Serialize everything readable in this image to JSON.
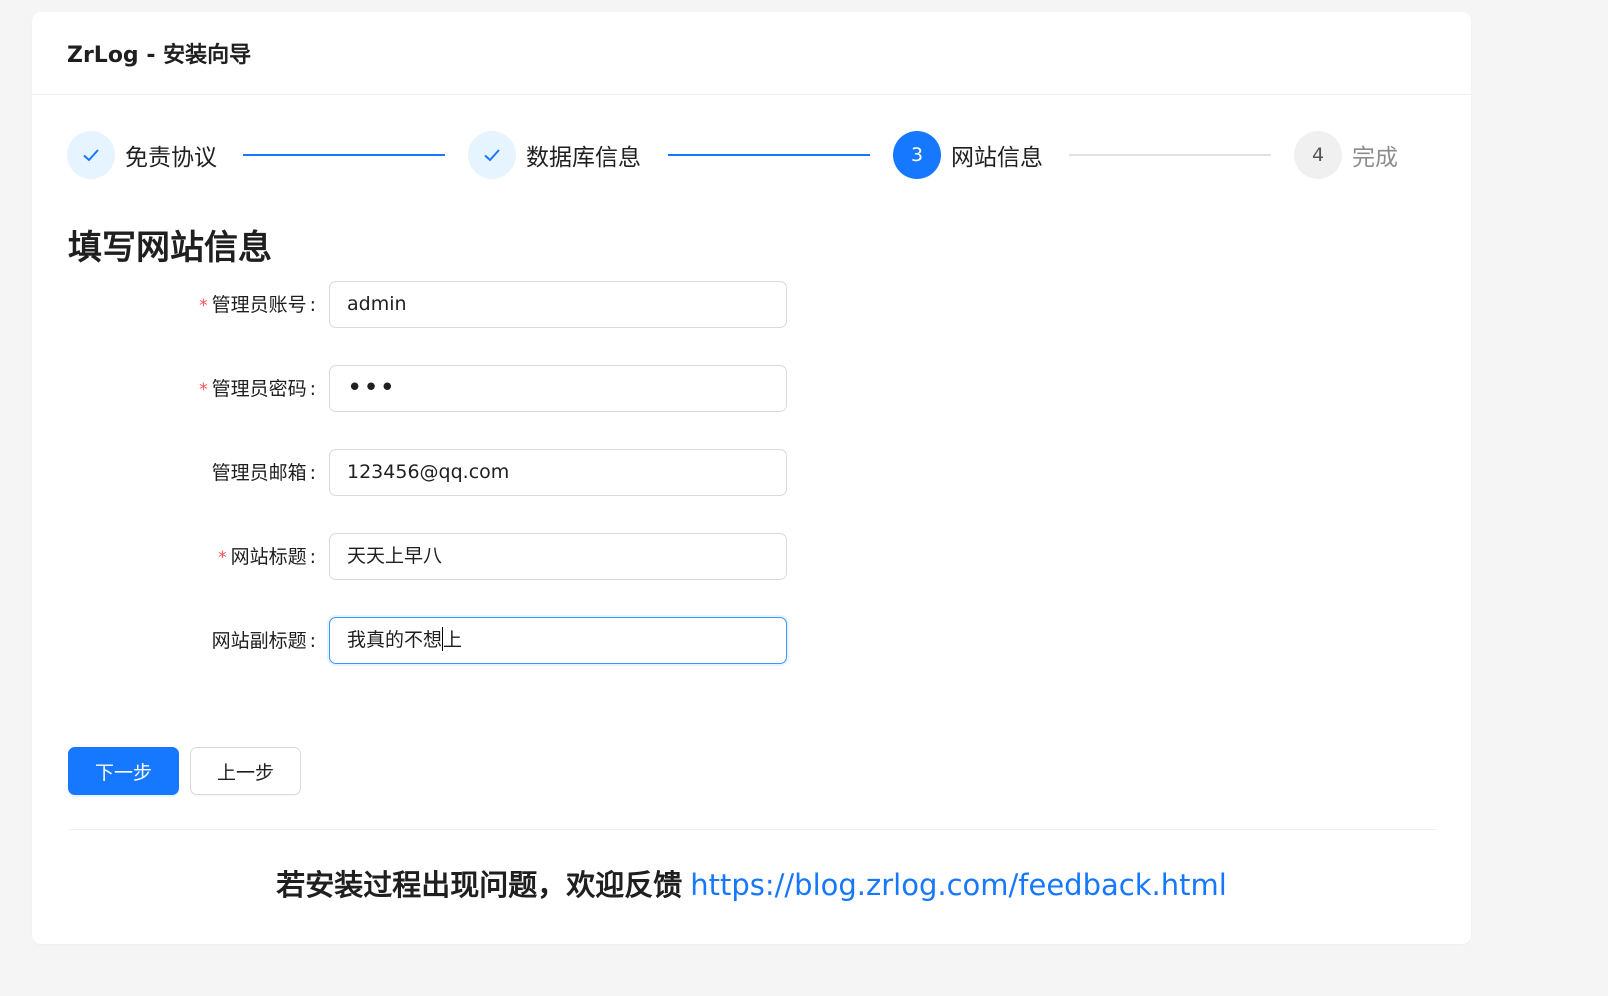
{
  "header": {
    "title": "ZrLog - 安装向导"
  },
  "steps": [
    {
      "label": "免责协议",
      "status": "done",
      "icon": "check-icon"
    },
    {
      "label": "数据库信息",
      "status": "done",
      "icon": "check-icon"
    },
    {
      "label": "网站信息",
      "status": "active",
      "number": "3"
    },
    {
      "label": "完成",
      "status": "wait",
      "number": "4"
    }
  ],
  "colors": {
    "primary": "#1677ff",
    "required": "#ff4d4f",
    "done_bg": "#e6f4ff"
  },
  "form": {
    "title": "填写网站信息",
    "fields": [
      {
        "label": "管理员账号",
        "required": true,
        "value": "admin"
      },
      {
        "label": "管理员密码",
        "required": true,
        "value": "•••",
        "type": "password"
      },
      {
        "label": "管理员邮箱",
        "required": false,
        "value": "123456@qq.com"
      },
      {
        "label": "网站标题",
        "required": true,
        "value": "天天上早八"
      },
      {
        "label": "网站副标题",
        "required": false,
        "value_before_caret": "我真的不想",
        "value_after_caret": "上",
        "focused": true
      }
    ],
    "colon": ":"
  },
  "buttons": {
    "next": "下一步",
    "prev": "上一步"
  },
  "footer": {
    "text": "若安装过程出现问题，欢迎反馈",
    "link": "https://blog.zrlog.com/feedback.html"
  }
}
